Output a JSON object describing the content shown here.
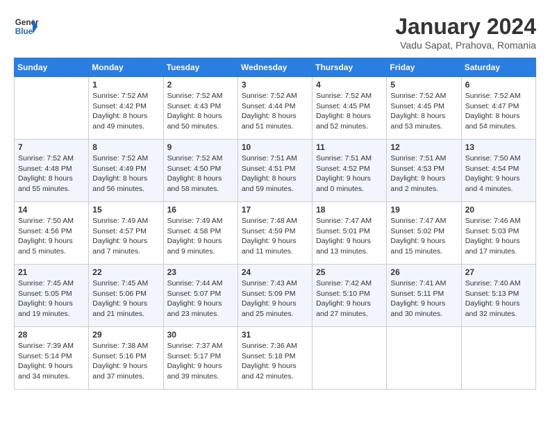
{
  "logo": {
    "text_general": "General",
    "text_blue": "Blue"
  },
  "header": {
    "month": "January 2024",
    "location": "Vadu Sapat, Prahova, Romania"
  },
  "weekdays": [
    "Sunday",
    "Monday",
    "Tuesday",
    "Wednesday",
    "Thursday",
    "Friday",
    "Saturday"
  ],
  "weeks": [
    [
      {
        "day": "",
        "sunrise": "",
        "sunset": "",
        "daylight": ""
      },
      {
        "day": "1",
        "sunrise": "Sunrise: 7:52 AM",
        "sunset": "Sunset: 4:42 PM",
        "daylight": "Daylight: 8 hours and 49 minutes."
      },
      {
        "day": "2",
        "sunrise": "Sunrise: 7:52 AM",
        "sunset": "Sunset: 4:43 PM",
        "daylight": "Daylight: 8 hours and 50 minutes."
      },
      {
        "day": "3",
        "sunrise": "Sunrise: 7:52 AM",
        "sunset": "Sunset: 4:44 PM",
        "daylight": "Daylight: 8 hours and 51 minutes."
      },
      {
        "day": "4",
        "sunrise": "Sunrise: 7:52 AM",
        "sunset": "Sunset: 4:45 PM",
        "daylight": "Daylight: 8 hours and 52 minutes."
      },
      {
        "day": "5",
        "sunrise": "Sunrise: 7:52 AM",
        "sunset": "Sunset: 4:45 PM",
        "daylight": "Daylight: 8 hours and 53 minutes."
      },
      {
        "day": "6",
        "sunrise": "Sunrise: 7:52 AM",
        "sunset": "Sunset: 4:47 PM",
        "daylight": "Daylight: 8 hours and 54 minutes."
      }
    ],
    [
      {
        "day": "7",
        "sunrise": "Sunrise: 7:52 AM",
        "sunset": "Sunset: 4:48 PM",
        "daylight": "Daylight: 8 hours and 55 minutes."
      },
      {
        "day": "8",
        "sunrise": "Sunrise: 7:52 AM",
        "sunset": "Sunset: 4:49 PM",
        "daylight": "Daylight: 8 hours and 56 minutes."
      },
      {
        "day": "9",
        "sunrise": "Sunrise: 7:52 AM",
        "sunset": "Sunset: 4:50 PM",
        "daylight": "Daylight: 8 hours and 58 minutes."
      },
      {
        "day": "10",
        "sunrise": "Sunrise: 7:51 AM",
        "sunset": "Sunset: 4:51 PM",
        "daylight": "Daylight: 8 hours and 59 minutes."
      },
      {
        "day": "11",
        "sunrise": "Sunrise: 7:51 AM",
        "sunset": "Sunset: 4:52 PM",
        "daylight": "Daylight: 9 hours and 0 minutes."
      },
      {
        "day": "12",
        "sunrise": "Sunrise: 7:51 AM",
        "sunset": "Sunset: 4:53 PM",
        "daylight": "Daylight: 9 hours and 2 minutes."
      },
      {
        "day": "13",
        "sunrise": "Sunrise: 7:50 AM",
        "sunset": "Sunset: 4:54 PM",
        "daylight": "Daylight: 9 hours and 4 minutes."
      }
    ],
    [
      {
        "day": "14",
        "sunrise": "Sunrise: 7:50 AM",
        "sunset": "Sunset: 4:56 PM",
        "daylight": "Daylight: 9 hours and 5 minutes."
      },
      {
        "day": "15",
        "sunrise": "Sunrise: 7:49 AM",
        "sunset": "Sunset: 4:57 PM",
        "daylight": "Daylight: 9 hours and 7 minutes."
      },
      {
        "day": "16",
        "sunrise": "Sunrise: 7:49 AM",
        "sunset": "Sunset: 4:58 PM",
        "daylight": "Daylight: 9 hours and 9 minutes."
      },
      {
        "day": "17",
        "sunrise": "Sunrise: 7:48 AM",
        "sunset": "Sunset: 4:59 PM",
        "daylight": "Daylight: 9 hours and 11 minutes."
      },
      {
        "day": "18",
        "sunrise": "Sunrise: 7:47 AM",
        "sunset": "Sunset: 5:01 PM",
        "daylight": "Daylight: 9 hours and 13 minutes."
      },
      {
        "day": "19",
        "sunrise": "Sunrise: 7:47 AM",
        "sunset": "Sunset: 5:02 PM",
        "daylight": "Daylight: 9 hours and 15 minutes."
      },
      {
        "day": "20",
        "sunrise": "Sunrise: 7:46 AM",
        "sunset": "Sunset: 5:03 PM",
        "daylight": "Daylight: 9 hours and 17 minutes."
      }
    ],
    [
      {
        "day": "21",
        "sunrise": "Sunrise: 7:45 AM",
        "sunset": "Sunset: 5:05 PM",
        "daylight": "Daylight: 9 hours and 19 minutes."
      },
      {
        "day": "22",
        "sunrise": "Sunrise: 7:45 AM",
        "sunset": "Sunset: 5:06 PM",
        "daylight": "Daylight: 9 hours and 21 minutes."
      },
      {
        "day": "23",
        "sunrise": "Sunrise: 7:44 AM",
        "sunset": "Sunset: 5:07 PM",
        "daylight": "Daylight: 9 hours and 23 minutes."
      },
      {
        "day": "24",
        "sunrise": "Sunrise: 7:43 AM",
        "sunset": "Sunset: 5:09 PM",
        "daylight": "Daylight: 9 hours and 25 minutes."
      },
      {
        "day": "25",
        "sunrise": "Sunrise: 7:42 AM",
        "sunset": "Sunset: 5:10 PM",
        "daylight": "Daylight: 9 hours and 27 minutes."
      },
      {
        "day": "26",
        "sunrise": "Sunrise: 7:41 AM",
        "sunset": "Sunset: 5:11 PM",
        "daylight": "Daylight: 9 hours and 30 minutes."
      },
      {
        "day": "27",
        "sunrise": "Sunrise: 7:40 AM",
        "sunset": "Sunset: 5:13 PM",
        "daylight": "Daylight: 9 hours and 32 minutes."
      }
    ],
    [
      {
        "day": "28",
        "sunrise": "Sunrise: 7:39 AM",
        "sunset": "Sunset: 5:14 PM",
        "daylight": "Daylight: 9 hours and 34 minutes."
      },
      {
        "day": "29",
        "sunrise": "Sunrise: 7:38 AM",
        "sunset": "Sunset: 5:16 PM",
        "daylight": "Daylight: 9 hours and 37 minutes."
      },
      {
        "day": "30",
        "sunrise": "Sunrise: 7:37 AM",
        "sunset": "Sunset: 5:17 PM",
        "daylight": "Daylight: 9 hours and 39 minutes."
      },
      {
        "day": "31",
        "sunrise": "Sunrise: 7:36 AM",
        "sunset": "Sunset: 5:18 PM",
        "daylight": "Daylight: 9 hours and 42 minutes."
      },
      {
        "day": "",
        "sunrise": "",
        "sunset": "",
        "daylight": ""
      },
      {
        "day": "",
        "sunrise": "",
        "sunset": "",
        "daylight": ""
      },
      {
        "day": "",
        "sunrise": "",
        "sunset": "",
        "daylight": ""
      }
    ]
  ]
}
